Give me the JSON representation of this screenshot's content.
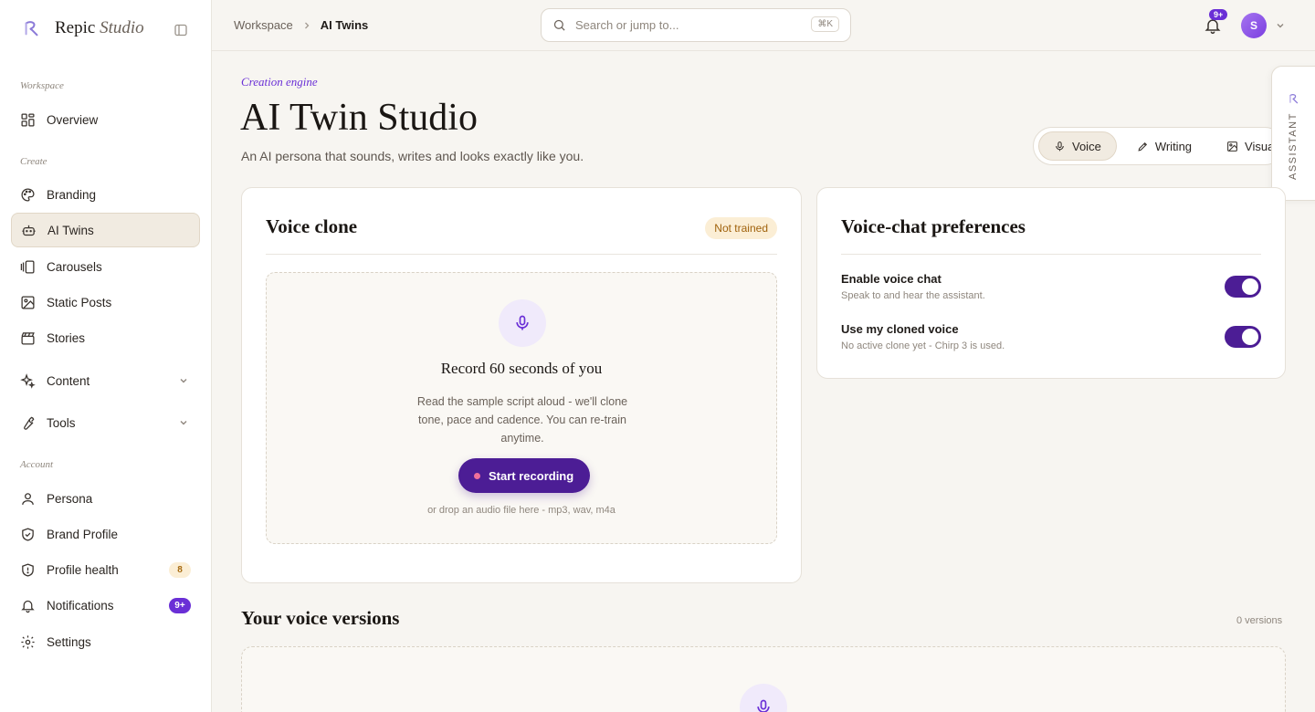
{
  "app": {
    "brand_name": "Repic",
    "brand_suffix": "Studio"
  },
  "sidebar": {
    "sections": {
      "workspace": "Workspace",
      "create": "Create",
      "account": "Account"
    },
    "items": [
      {
        "label": "Overview"
      },
      {
        "label": "Branding"
      },
      {
        "label": "AI Twins"
      },
      {
        "label": "Carousels"
      },
      {
        "label": "Static Posts"
      },
      {
        "label": "Stories"
      },
      {
        "label": "Content"
      },
      {
        "label": "Tools"
      },
      {
        "label": "Persona"
      },
      {
        "label": "Brand Profile"
      },
      {
        "label": "Profile health",
        "badge": "8"
      },
      {
        "label": "Notifications",
        "badge": "9+"
      },
      {
        "label": "Settings"
      }
    ]
  },
  "topbar": {
    "breadcrumb": [
      "Workspace",
      "AI Twins"
    ],
    "search_placeholder": "Search or jump to...",
    "search_shortcut": "⌘K",
    "notifications_badge": "9+",
    "avatar_initial": "S"
  },
  "page": {
    "eyebrow": "Creation engine",
    "title": "AI Twin Studio",
    "subtitle": "An AI persona that sounds, writes and looks exactly like you.",
    "tabs": [
      {
        "label": "Voice",
        "active": true
      },
      {
        "label": "Writing",
        "active": false
      },
      {
        "label": "Visual",
        "active": false
      }
    ]
  },
  "assistant": {
    "label": "ASSISTANT"
  },
  "voice_clone": {
    "title": "Voice clone",
    "status": "Not trained",
    "record_title": "Record 60 seconds of you",
    "record_desc": "Read the sample script aloud - we'll clone tone, pace and cadence. You can re-train anytime.",
    "record_button": "Start recording",
    "drop_hint": "or drop an audio file here - mp3, wav, m4a"
  },
  "preferences": {
    "title": "Voice-chat preferences",
    "items": [
      {
        "title": "Enable voice chat",
        "desc": "Speak to and hear the assistant.",
        "enabled": true
      },
      {
        "title": "Use my cloned voice",
        "desc": "No active clone yet - Chirp 3 is used.",
        "enabled": true
      }
    ]
  },
  "versions": {
    "title": "Your voice versions",
    "count": "0 versions"
  },
  "colors": {
    "accent": "#4c1d95",
    "accent_bright": "#6a2fd6",
    "warning_bg": "#fbeed5",
    "background": "#f7f5f1"
  }
}
